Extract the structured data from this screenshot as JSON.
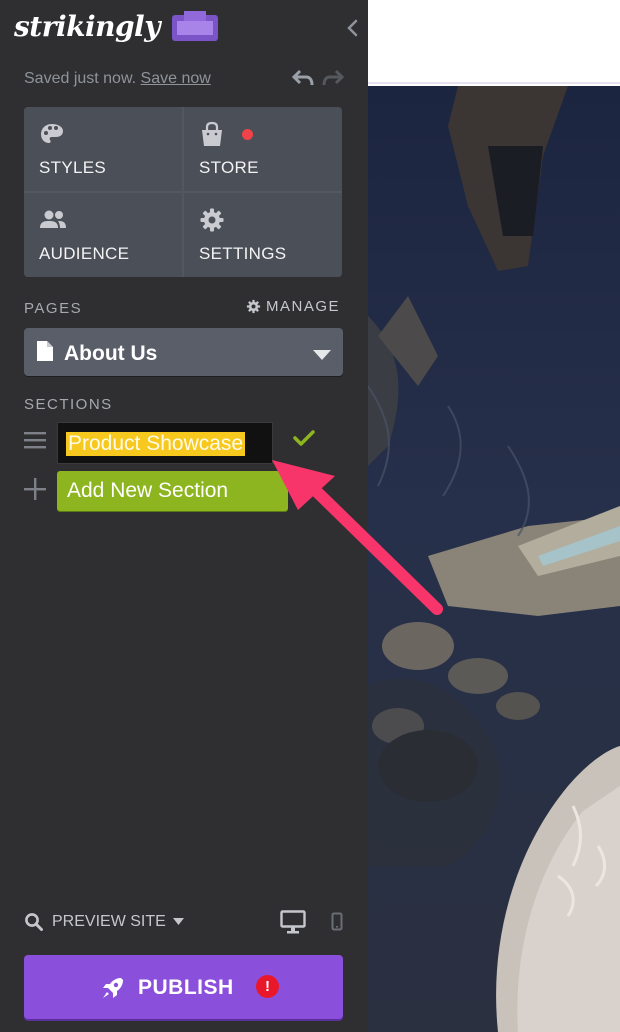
{
  "app": {
    "logo_text": "strikingly"
  },
  "status": {
    "saved_text": "Saved just now.",
    "save_link": "Save now"
  },
  "tiles": [
    {
      "label": "STYLES",
      "icon": "palette-icon"
    },
    {
      "label": "STORE",
      "icon": "shopping-bag-icon",
      "notification": true
    },
    {
      "label": "AUDIENCE",
      "icon": "people-icon"
    },
    {
      "label": "SETTINGS",
      "icon": "gear-icon"
    }
  ],
  "pages": {
    "heading": "PAGES",
    "manage_label": "MANAGE",
    "current_page": "About Us"
  },
  "sections": {
    "heading": "SECTIONS",
    "editing_value": "Product Showcase",
    "add_label": "Add New Section"
  },
  "footer": {
    "preview_label": "PREVIEW SITE",
    "publish_label": "PUBLISH",
    "publish_warning": "!"
  },
  "colors": {
    "accent_green": "#8cb51f",
    "publish_purple": "#8a50dc",
    "selection_yellow": "#f7c81d",
    "annotation_arrow": "#f7356b",
    "sidebar_bg": "#2f2f31",
    "tile_bg": "#4b4f58"
  }
}
